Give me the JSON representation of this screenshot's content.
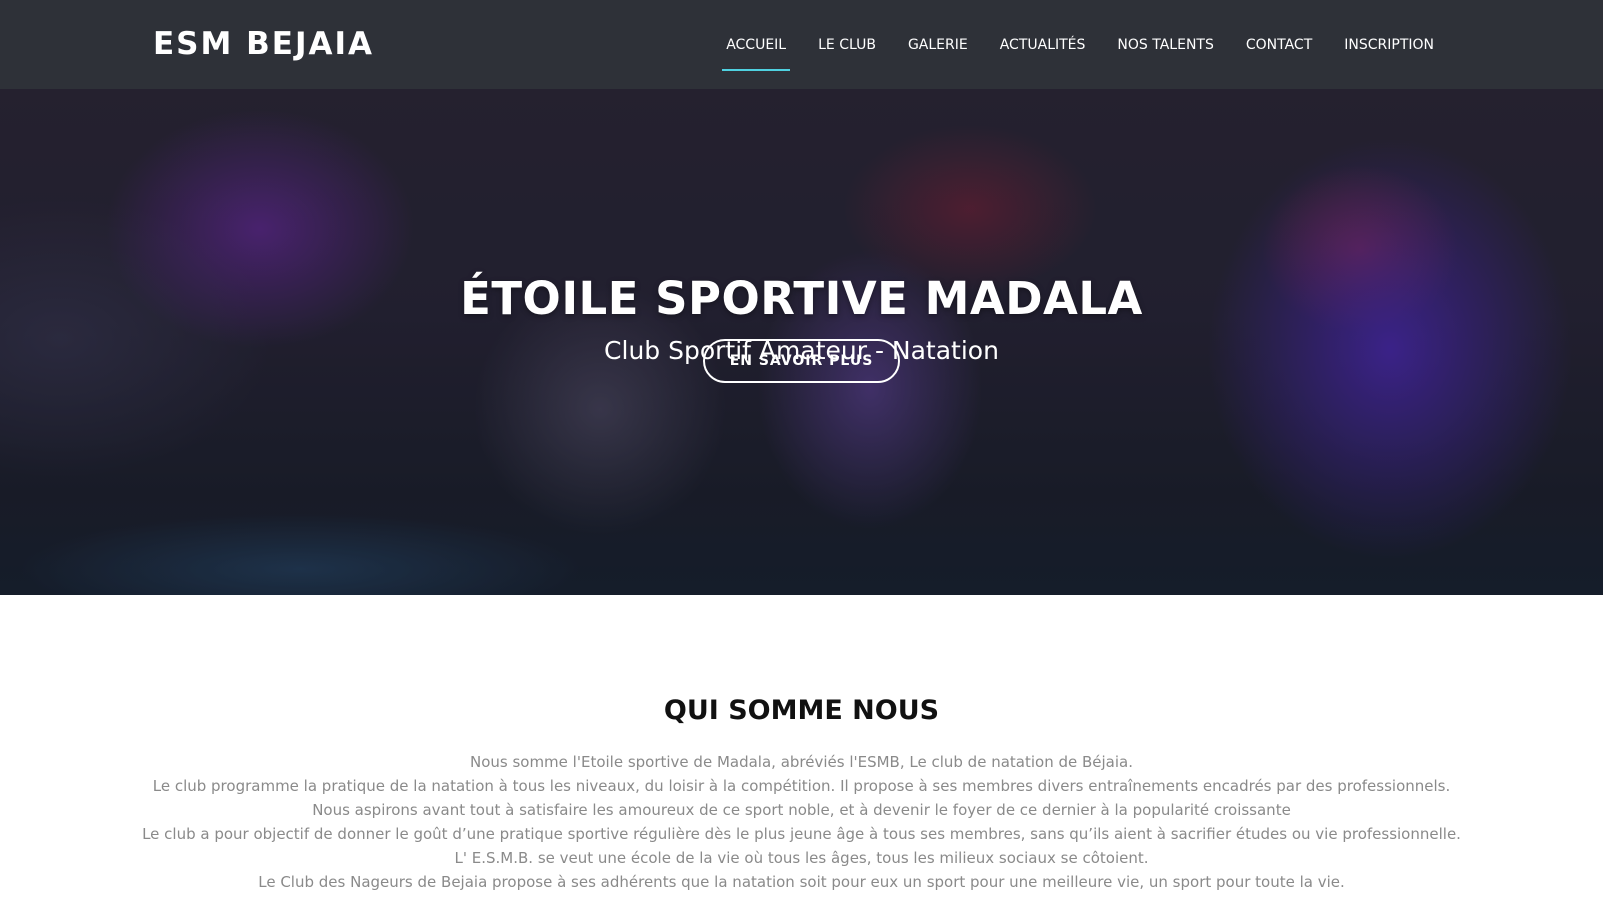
{
  "navbar": {
    "brand": "ESM BEJAIA",
    "items": [
      {
        "label": "ACCUEIL",
        "active": true
      },
      {
        "label": "LE CLUB",
        "active": false
      },
      {
        "label": "GALERIE",
        "active": false
      },
      {
        "label": "ACTUALITÉS",
        "active": false
      },
      {
        "label": "NOS TALENTS",
        "active": false
      },
      {
        "label": "CONTACT",
        "active": false
      },
      {
        "label": "INSCRIPTION",
        "active": false
      }
    ],
    "accent_color": "#4fd1e0"
  },
  "hero": {
    "title": "ÉTOILE SPORTIVE MADALA",
    "subtitle": "Club Sportif Amateur - Natation",
    "button_label": "EN SAVOIR PLUS"
  },
  "about": {
    "title": "QUI SOMME NOUS",
    "lines": [
      "Nous somme l'Etoile sportive de Madala, abréviés l'ESMB, Le club de natation de Béjaia.",
      "Le club programme la pratique de la natation à tous les niveaux, du loisir à la compétition. Il propose à ses membres divers entraînements encadrés par des professionnels.",
      "Nous aspirons avant tout à satisfaire les amoureux de ce sport noble, et à devenir le foyer de ce dernier à la popularité croissante",
      "Le club a pour objectif de donner le goût d’une pratique sportive régulière dès le plus jeune âge à tous ses membres, sans qu’ils aient à sacrifier études ou vie professionnelle.",
      "L' E.S.M.B. se veut une école de la vie où tous les âges, tous les milieux sociaux se côtoient.",
      "Le Club des Nageurs de Bejaia propose à ses adhérents que la natation soit pour eux un sport pour une meilleure vie, un sport pour toute la vie."
    ]
  }
}
